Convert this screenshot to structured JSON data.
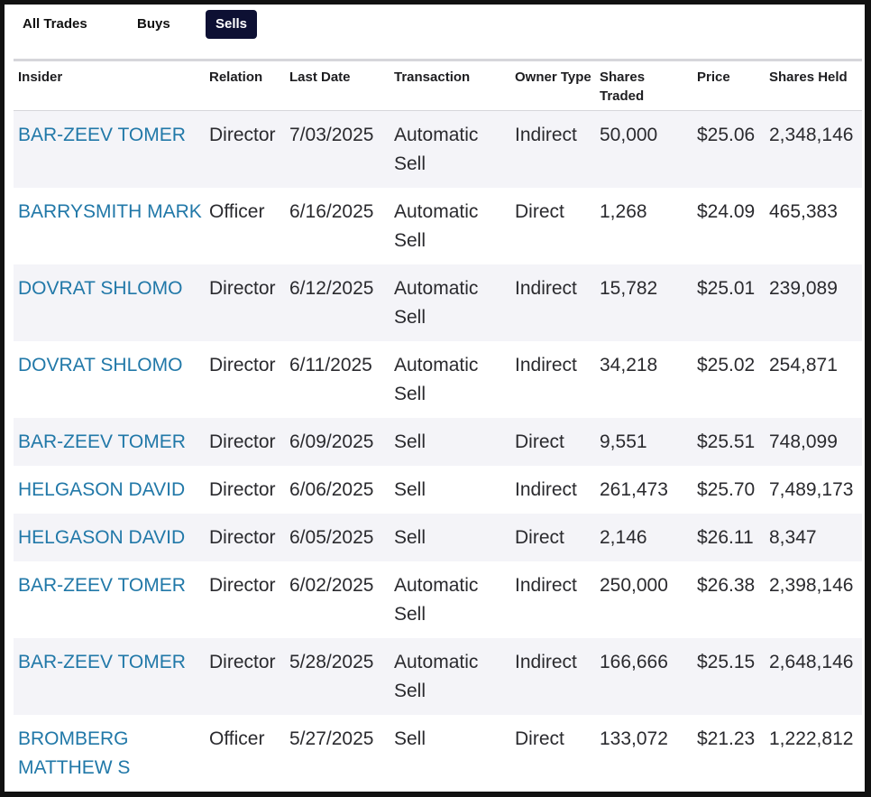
{
  "tabs": {
    "all": "All Trades",
    "buys": "Buys",
    "sells": "Sells",
    "active": "Sells"
  },
  "table": {
    "headers": {
      "insider": "Insider",
      "relation": "Relation",
      "last_date": "Last Date",
      "transaction": "Transaction",
      "owner_type": "Owner Type",
      "shares_traded": "Shares Traded",
      "price": "Price",
      "shares_held": "Shares Held"
    },
    "rows": [
      {
        "insider": "BAR-ZEEV TOMER",
        "relation": "Director",
        "last_date": "7/03/2025",
        "transaction": "Automatic Sell",
        "owner_type": "Indirect",
        "shares_traded": "50,000",
        "price": "$25.06",
        "shares_held": "2,348,146"
      },
      {
        "insider": "BARRYSMITH MARK",
        "relation": "Officer",
        "last_date": "6/16/2025",
        "transaction": "Automatic Sell",
        "owner_type": "Direct",
        "shares_traded": "1,268",
        "price": "$24.09",
        "shares_held": "465,383"
      },
      {
        "insider": "DOVRAT SHLOMO",
        "relation": "Director",
        "last_date": "6/12/2025",
        "transaction": "Automatic Sell",
        "owner_type": "Indirect",
        "shares_traded": "15,782",
        "price": "$25.01",
        "shares_held": "239,089"
      },
      {
        "insider": "DOVRAT SHLOMO",
        "relation": "Director",
        "last_date": "6/11/2025",
        "transaction": "Automatic Sell",
        "owner_type": "Indirect",
        "shares_traded": "34,218",
        "price": "$25.02",
        "shares_held": "254,871"
      },
      {
        "insider": "BAR-ZEEV TOMER",
        "relation": "Director",
        "last_date": "6/09/2025",
        "transaction": "Sell",
        "owner_type": "Direct",
        "shares_traded": "9,551",
        "price": "$25.51",
        "shares_held": "748,099"
      },
      {
        "insider": "HELGASON DAVID",
        "relation": "Director",
        "last_date": "6/06/2025",
        "transaction": "Sell",
        "owner_type": "Indirect",
        "shares_traded": "261,473",
        "price": "$25.70",
        "shares_held": "7,489,173"
      },
      {
        "insider": "HELGASON DAVID",
        "relation": "Director",
        "last_date": "6/05/2025",
        "transaction": "Sell",
        "owner_type": "Direct",
        "shares_traded": "2,146",
        "price": "$26.11",
        "shares_held": "8,347"
      },
      {
        "insider": "BAR-ZEEV TOMER",
        "relation": "Director",
        "last_date": "6/02/2025",
        "transaction": "Automatic Sell",
        "owner_type": "Indirect",
        "shares_traded": "250,000",
        "price": "$26.38",
        "shares_held": "2,398,146"
      },
      {
        "insider": "BAR-ZEEV TOMER",
        "relation": "Director",
        "last_date": "5/28/2025",
        "transaction": "Automatic Sell",
        "owner_type": "Indirect",
        "shares_traded": "166,666",
        "price": "$25.15",
        "shares_held": "2,648,146"
      },
      {
        "insider": "BROMBERG MATTHEW S",
        "relation": "Officer",
        "last_date": "5/27/2025",
        "transaction": "Sell",
        "owner_type": "Direct",
        "shares_traded": "133,072",
        "price": "$21.23",
        "shares_held": "1,222,812"
      }
    ]
  }
}
